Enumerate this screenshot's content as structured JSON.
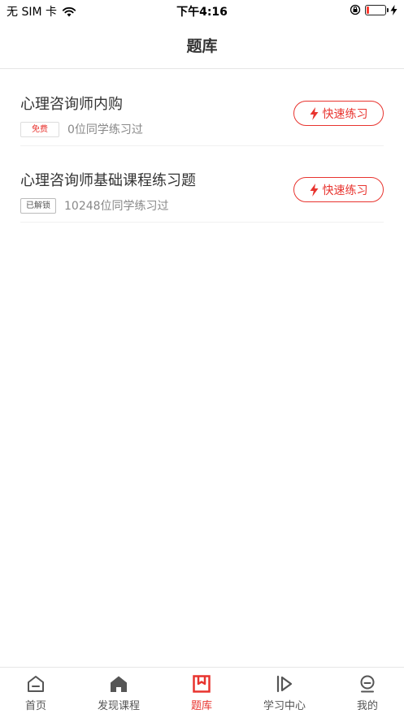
{
  "status_bar": {
    "carrier": "无 SIM 卡",
    "time": "下午4:16",
    "battery_level": 0.15
  },
  "header": {
    "title": "题库"
  },
  "items": [
    {
      "title": "心理咨询师内购",
      "tag": "免费",
      "learners": "0位同学练习过",
      "button": "快速练习"
    },
    {
      "title": "心理咨询师基础课程练习题",
      "tag": "已解锁",
      "learners": "10248位同学练习过",
      "button": "快速练习"
    }
  ],
  "tabbar": {
    "tabs": [
      {
        "label": "首页",
        "icon": "home-icon"
      },
      {
        "label": "发现课程",
        "icon": "house-filled-icon"
      },
      {
        "label": "题库",
        "icon": "question-bank-icon"
      },
      {
        "label": "学习中心",
        "icon": "play-icon"
      },
      {
        "label": "我的",
        "icon": "profile-icon"
      }
    ],
    "active_index": 2
  },
  "colors": {
    "accent": "#e8342f",
    "text": "#333333",
    "muted": "#888888"
  }
}
